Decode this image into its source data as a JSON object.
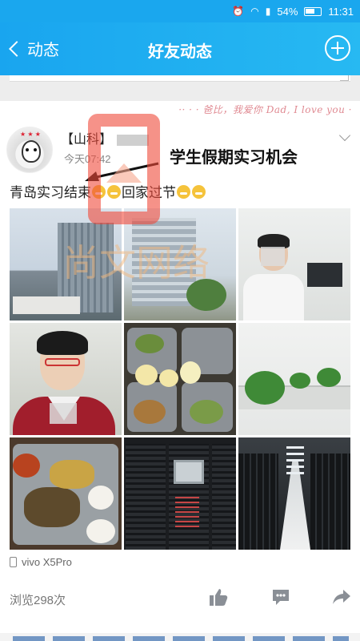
{
  "status": {
    "battery": "54%",
    "time": "11:31"
  },
  "nav": {
    "back_label": "动态",
    "title": "好友动态"
  },
  "post": {
    "author": "【山科】",
    "time": "今天07:42",
    "overlay_text": "学生假期实习机会",
    "text": "青岛实习结束",
    "text2": "回家过节",
    "deco": "··  · · 爸比，我爱你 Dad, I love you ·",
    "watermark": "尚文网络",
    "device": "vivo X5Pro",
    "views": "浏览298次"
  },
  "icons": {
    "back": "chevron-left-icon",
    "add": "plus-circle-icon",
    "expand": "chevron-down-icon",
    "like": "thumbs-up-icon",
    "comment": "comment-icon",
    "share": "share-icon",
    "device": "phone-icon"
  },
  "photos": [
    "campus-building-photo",
    "office-building-photo",
    "student-at-desk-photo",
    "selfie-photo",
    "meal-trays-photo",
    "office-plants-photo",
    "meal-plate-photo",
    "server-rack-photo",
    "data-center-aisle-photo"
  ],
  "colors": {
    "header": "#1aa7ee",
    "watermark": "#f04a3a"
  }
}
